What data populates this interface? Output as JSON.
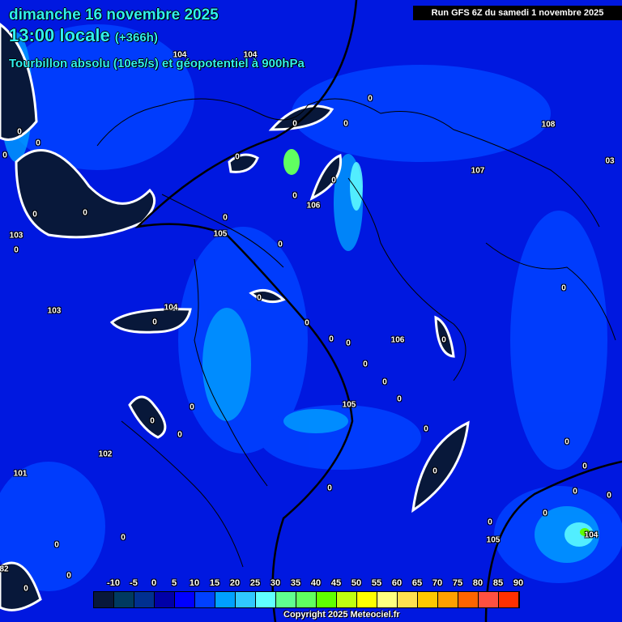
{
  "header": {
    "date": "dimanche 16 novembre 2025",
    "time": "13:00 locale",
    "lead": "(+366h)",
    "parameter": "Tourbillon absolu (10e5/s) et géopotentiel à 900hPa",
    "run": "Run GFS 6Z du samedi 1 novembre 2025"
  },
  "contour_labels": [
    "104",
    "104",
    "0",
    "0",
    "0",
    "108",
    "0",
    "0",
    "0",
    "0",
    "107",
    "0",
    "03",
    "0",
    "106",
    "0",
    "0",
    "0",
    "105",
    "103",
    "0",
    "0",
    "0",
    "0",
    "103",
    "104",
    "0",
    "0",
    "0",
    "0",
    "106",
    "0",
    "0",
    "0",
    "0",
    "105",
    "0",
    "0",
    "0",
    "0",
    "0",
    "102",
    "101",
    "0",
    "0",
    "0",
    "0",
    "0",
    "0",
    "0",
    "0",
    "0",
    "105",
    "104",
    "0",
    "82",
    "0"
  ],
  "legend": {
    "ticks": [
      "-10",
      "-5",
      "0",
      "5",
      "10",
      "15",
      "20",
      "25",
      "30",
      "35",
      "40",
      "45",
      "50",
      "55",
      "60",
      "65",
      "70",
      "75",
      "80",
      "85",
      "90"
    ],
    "colors": [
      "#08183a",
      "#003a60",
      "#003090",
      "#0000a8",
      "#0000ff",
      "#0040ff",
      "#00a0ff",
      "#30c8ff",
      "#60ffff",
      "#60ff90",
      "#60ff60",
      "#60ff00",
      "#c0ff10",
      "#ffff00",
      "#ffff80",
      "#ffe050",
      "#ffc800",
      "#ffa000",
      "#ff6400",
      "#ff5040",
      "#ff3000"
    ]
  },
  "copyright": "Copyright 2025 Meteociel.fr"
}
